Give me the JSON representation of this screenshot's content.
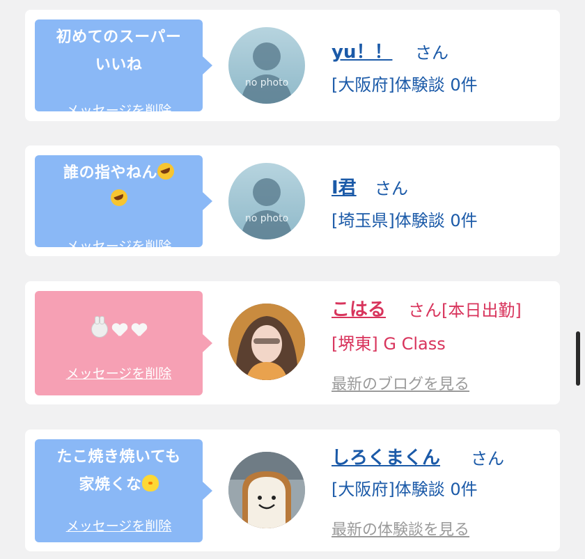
{
  "entries": [
    {
      "message_line1": "初めてのスーパー",
      "message_line2": "いいね",
      "delete_label": "メッセージを削除",
      "avatar_label": "no photo",
      "name": "yu！！",
      "honorific": "さん",
      "info": "[大阪府]体験談 0件"
    },
    {
      "message_line1": "誰の指やねん",
      "message_line2": "",
      "emoji": "rofl-emoji",
      "delete_label": "メッセージを削除",
      "avatar_label": "no photo",
      "name": "I君",
      "honorific": "さん",
      "info": "[埼玉県]体験談 0件"
    },
    {
      "message_emojis": [
        "rabbit-emoji",
        "white-heart-emoji",
        "white-heart-emoji"
      ],
      "delete_label": "メッセージを削除",
      "name": "こはる",
      "honorific": "さん[本日出勤]",
      "info": "[堺東] G Class",
      "latest_link": "最新のブログを見る"
    },
    {
      "message_line1": "たこ焼き焼いても",
      "message_line2": "家焼くな",
      "emoji": "chick-emoji",
      "delete_label": "メッセージを削除",
      "name": "しろくまくん",
      "honorific": "さん",
      "info": "[大阪府]体験談 0件",
      "latest_link": "最新の体験談を見る"
    }
  ],
  "colors": {
    "bubble_blue": "#8ab8f6",
    "bubble_pink": "#f6a0b4",
    "link_blue": "#1b5aa8",
    "link_pink": "#d8345c",
    "muted_link": "#9a9a9a",
    "background": "#f1f1f2"
  }
}
